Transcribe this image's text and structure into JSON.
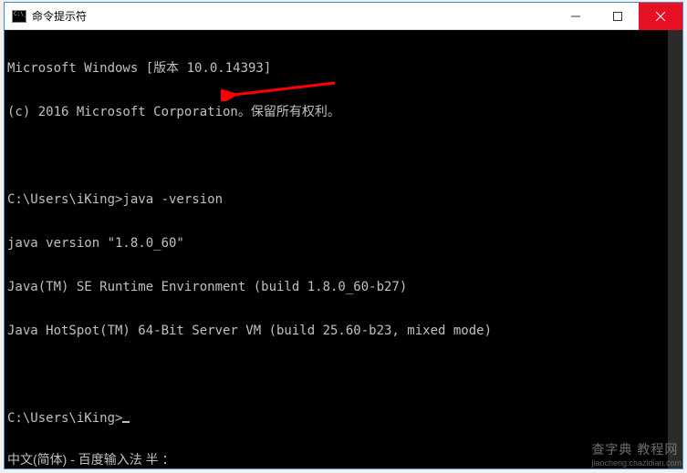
{
  "window": {
    "title": "命令提示符"
  },
  "terminal": {
    "lines": [
      "Microsoft Windows [版本 10.0.14393]",
      "(c) 2016 Microsoft Corporation。保留所有权利。",
      "",
      "C:\\Users\\iKing>java -version",
      "java version \"1.8.0_60\"",
      "Java(TM) SE Runtime Environment (build 1.8.0_60-b27)",
      "Java HotSpot(TM) 64-Bit Server VM (build 25.60-b23, mixed mode)",
      "",
      "C:\\Users\\iKing>"
    ],
    "prompt_path": "C:\\Users\\iKing",
    "command": "java -version",
    "java_version": "1.8.0_60",
    "jre_build": "1.8.0_60-b27",
    "hotspot_build": "25.60-b23",
    "hotspot_mode": "mixed mode"
  },
  "ime": {
    "status": "中文(简体) - 百度输入法 半 ："
  },
  "watermark": {
    "main": "查字典 教程网",
    "sub": "jiaocheng.chazidian.com"
  },
  "annotation": {
    "arrow_color": "#ff0000"
  }
}
